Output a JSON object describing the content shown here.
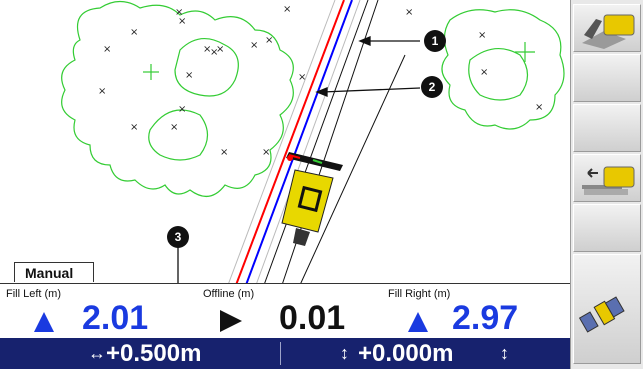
{
  "mode_tab": "Manual",
  "readouts": {
    "fill_left": {
      "label": "Fill Left (m)",
      "value": "2.01"
    },
    "offline": {
      "label": "Offline (m)",
      "value": "0.01"
    },
    "fill_right": {
      "label": "Fill Right (m)",
      "value": "2.97"
    }
  },
  "status_bar": {
    "horizontal_offset": "+0.500m",
    "vertical_offset": "+0.000m"
  },
  "callouts": [
    "1",
    "2",
    "3"
  ],
  "side_buttons": [
    {
      "icon": "blade-machine-icon"
    },
    {
      "icon": "blank"
    },
    {
      "icon": "blank"
    },
    {
      "icon": "offset-blade-icon"
    },
    {
      "icon": "blank"
    },
    {
      "icon": "satellite-icon"
    }
  ],
  "colors": {
    "status_bar_bg": "#17226e",
    "value_blue": "#1a3ae0",
    "tree_green": "#33cc33",
    "design_red": "#ff0000",
    "design_blue": "#0000ff"
  }
}
